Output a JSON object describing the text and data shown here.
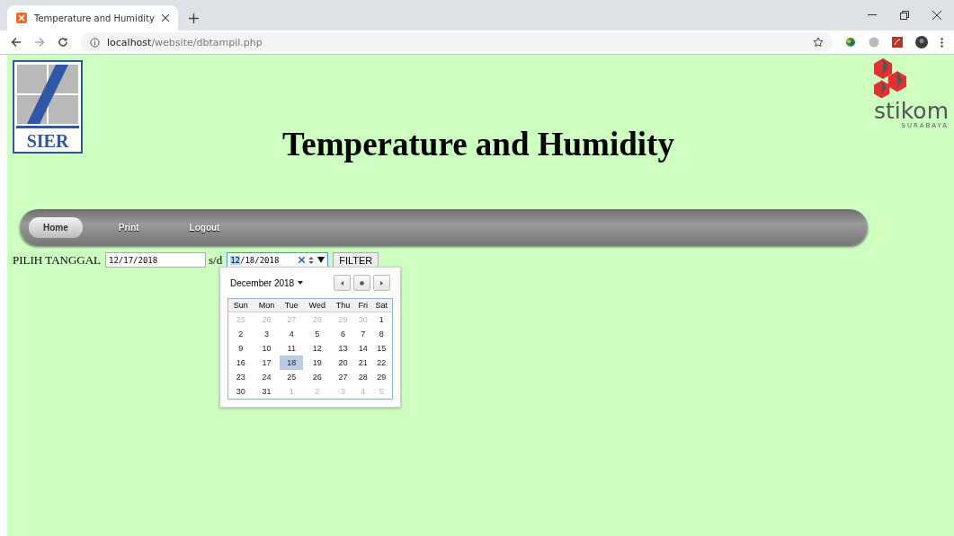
{
  "browser": {
    "tab": {
      "title": "Temperature and Humidity",
      "selected": true
    },
    "url": {
      "host": "localhost",
      "path": "/website/dbtampil.php"
    }
  },
  "header": {
    "left_logo": {
      "text": "SIER"
    },
    "title": "Temperature and Humidity",
    "right_logo": {
      "name": "stikom",
      "city": "SURABAYA"
    }
  },
  "nav": [
    {
      "label": "Home",
      "selected": true
    },
    {
      "label": "Print",
      "selected": false
    },
    {
      "label": "Logout",
      "selected": false
    }
  ],
  "filter": {
    "label": "PILIH TANGGAL",
    "from": {
      "value": "12/17/2018"
    },
    "separator": "s/d",
    "to": {
      "value": "12/18/2018",
      "focused": true
    },
    "button": "FILTER"
  },
  "calendar": {
    "month": "December 2018",
    "weekdays": [
      "Sun",
      "Mon",
      "Tue",
      "Wed",
      "Thu",
      "Fri",
      "Sat"
    ],
    "weeks": [
      [
        {
          "day": "25",
          "muted": true,
          "selected": false
        },
        {
          "day": "26",
          "muted": true,
          "selected": false
        },
        {
          "day": "27",
          "muted": true,
          "selected": false
        },
        {
          "day": "28",
          "muted": true,
          "selected": false
        },
        {
          "day": "29",
          "muted": true,
          "selected": false
        },
        {
          "day": "30",
          "muted": true,
          "selected": false
        },
        {
          "day": "1",
          "muted": false,
          "selected": false
        }
      ],
      [
        {
          "day": "2",
          "muted": false,
          "selected": false
        },
        {
          "day": "3",
          "muted": false,
          "selected": false
        },
        {
          "day": "4",
          "muted": false,
          "selected": false
        },
        {
          "day": "5",
          "muted": false,
          "selected": false
        },
        {
          "day": "6",
          "muted": false,
          "selected": false
        },
        {
          "day": "7",
          "muted": false,
          "selected": false
        },
        {
          "day": "8",
          "muted": false,
          "selected": false
        }
      ],
      [
        {
          "day": "9",
          "muted": false,
          "selected": false
        },
        {
          "day": "10",
          "muted": false,
          "selected": false
        },
        {
          "day": "11",
          "muted": false,
          "selected": false
        },
        {
          "day": "12",
          "muted": false,
          "selected": false
        },
        {
          "day": "13",
          "muted": false,
          "selected": false
        },
        {
          "day": "14",
          "muted": false,
          "selected": false
        },
        {
          "day": "15",
          "muted": false,
          "selected": false
        }
      ],
      [
        {
          "day": "16",
          "muted": false,
          "selected": false
        },
        {
          "day": "17",
          "muted": false,
          "selected": false
        },
        {
          "day": "18",
          "muted": false,
          "selected": true
        },
        {
          "day": "19",
          "muted": false,
          "selected": false
        },
        {
          "day": "20",
          "muted": false,
          "selected": false
        },
        {
          "day": "21",
          "muted": false,
          "selected": false
        },
        {
          "day": "22",
          "muted": false,
          "selected": false
        }
      ],
      [
        {
          "day": "23",
          "muted": false,
          "selected": false
        },
        {
          "day": "24",
          "muted": false,
          "selected": false
        },
        {
          "day": "25",
          "muted": false,
          "selected": false
        },
        {
          "day": "26",
          "muted": false,
          "selected": false
        },
        {
          "day": "27",
          "muted": false,
          "selected": false
        },
        {
          "day": "28",
          "muted": false,
          "selected": false
        },
        {
          "day": "29",
          "muted": false,
          "selected": false
        }
      ],
      [
        {
          "day": "30",
          "muted": false,
          "selected": false
        },
        {
          "day": "31",
          "muted": false,
          "selected": false
        },
        {
          "day": "1",
          "muted": true,
          "selected": false
        },
        {
          "day": "2",
          "muted": true,
          "selected": false
        },
        {
          "day": "3",
          "muted": true,
          "selected": false
        },
        {
          "day": "4",
          "muted": true,
          "selected": false
        },
        {
          "day": "5",
          "muted": true,
          "selected": false
        }
      ]
    ]
  }
}
